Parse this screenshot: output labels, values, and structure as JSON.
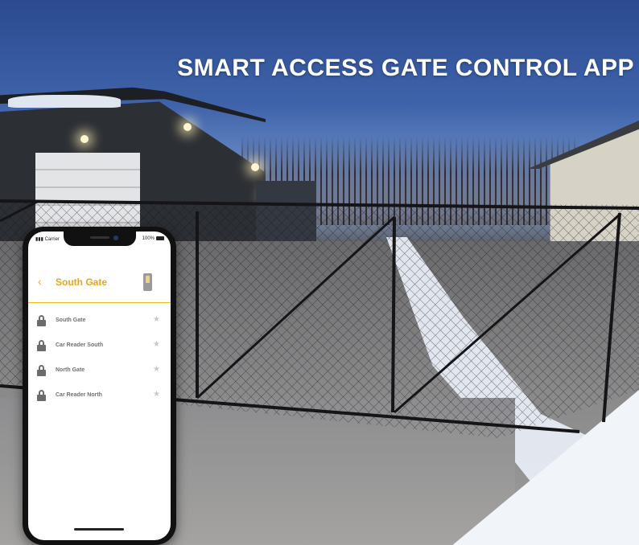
{
  "headline": "SMART ACCESS GATE CONTROL APP",
  "phone": {
    "status": {
      "carrier": "Carrier",
      "battery": "100%"
    },
    "header": {
      "back_icon": "chevron-left-icon",
      "title": "South Gate",
      "device_icon": "keypad-icon"
    },
    "gates": [
      {
        "label": "South Gate",
        "icon": "lock-icon",
        "favorite_icon": "star-icon"
      },
      {
        "label": "Car Reader South",
        "icon": "lock-icon",
        "favorite_icon": "star-icon"
      },
      {
        "label": "North Gate",
        "icon": "lock-icon",
        "favorite_icon": "star-icon"
      },
      {
        "label": "Car Reader North",
        "icon": "lock-icon",
        "favorite_icon": "star-icon"
      }
    ]
  },
  "colors": {
    "accent": "#e9a519",
    "sky_top": "#2b4a8f",
    "headline": "#ffffff"
  }
}
